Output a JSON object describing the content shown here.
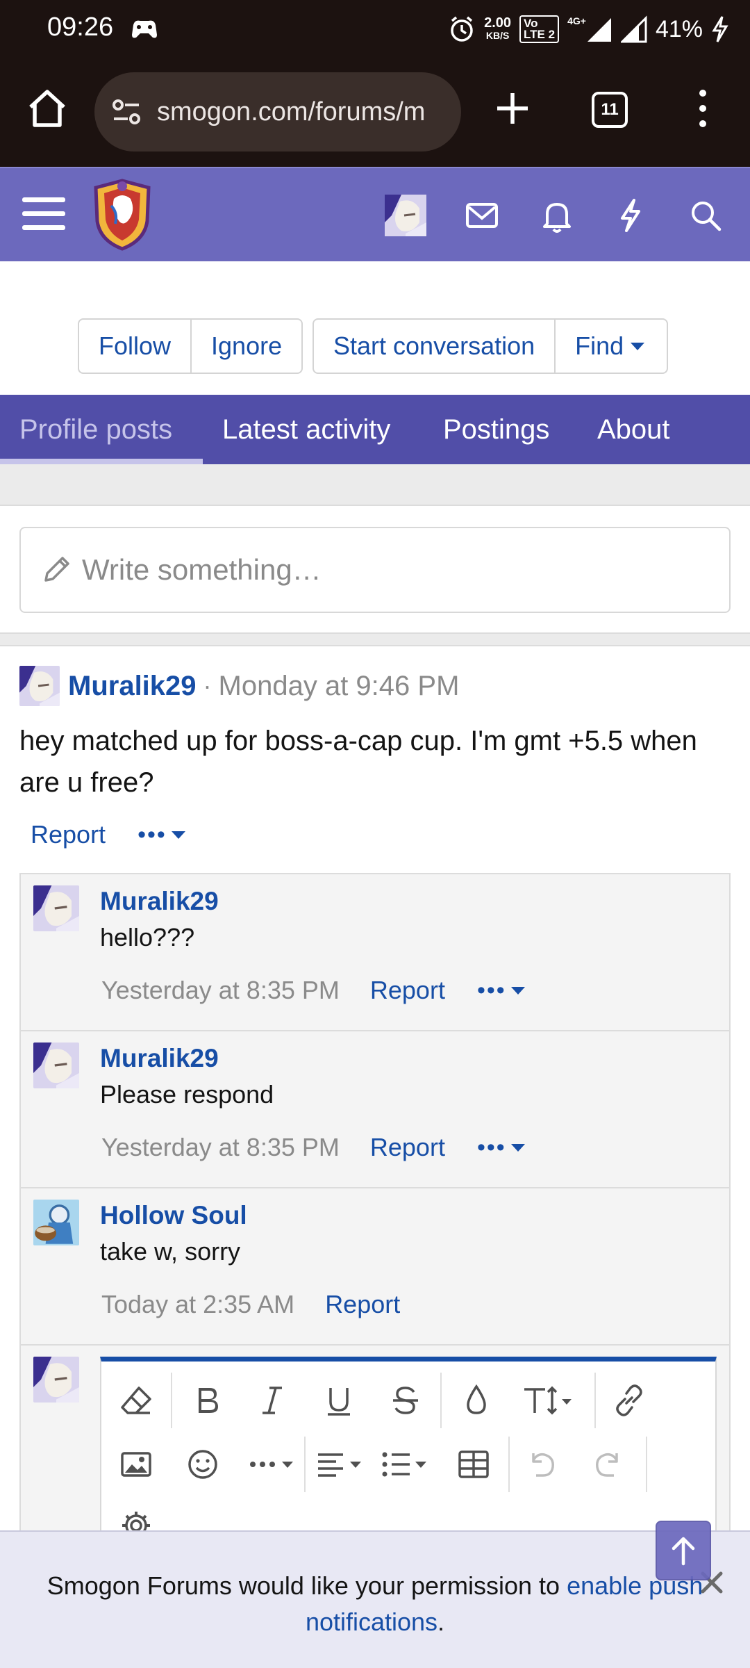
{
  "status_bar": {
    "time": "09:26",
    "net_speed_value": "2.00",
    "net_speed_unit": "KB/S",
    "volte_line1": "Vo",
    "volte_line2": "LTE 2",
    "network": "4G+",
    "battery": "41%"
  },
  "browser": {
    "url": "smogon.com/forums/m",
    "tab_count": "11"
  },
  "profile_buttons": {
    "follow": "Follow",
    "ignore": "Ignore",
    "start_conversation": "Start conversation",
    "find": "Find"
  },
  "tabs": [
    {
      "label": "Profile posts",
      "active": true
    },
    {
      "label": "Latest activity",
      "active": false
    },
    {
      "label": "Postings",
      "active": false
    },
    {
      "label": "About",
      "active": false
    }
  ],
  "write_placeholder": "Write something…",
  "post": {
    "author": "Muralik29",
    "separator": "·",
    "date": "Monday at 9:46 PM",
    "body": "hey matched up for boss-a-cap cup. I'm gmt +5.5 when are u free?",
    "report": "Report",
    "more": "•••"
  },
  "comments": [
    {
      "author": "Muralik29",
      "text": "hello???",
      "time": "Yesterday at 8:35 PM",
      "report": "Report",
      "more": "•••"
    },
    {
      "author": "Muralik29",
      "text": "Please respond",
      "time": "Yesterday at 8:35 PM",
      "report": "Report",
      "more": "•••"
    },
    {
      "author": "Hollow Soul",
      "text": "take w, sorry",
      "time": "Today at 2:35 AM",
      "report": "Report"
    }
  ],
  "editor_toolbar": [
    "eraser-icon",
    "bold-icon",
    "italic-icon",
    "underline-icon",
    "strikethrough-icon",
    "color-icon",
    "text-size-icon",
    "link-icon",
    "image-icon",
    "emoji-icon",
    "more-options-icon",
    "align-icon",
    "list-icon",
    "table-icon",
    "undo-icon",
    "redo-icon",
    "settings-icon"
  ],
  "notification": {
    "text_before": "Smogon Forums would like your permission to ",
    "link_text": "enable push notifications",
    "text_after": "."
  },
  "colors": {
    "header": "#6c69bd",
    "tabs": "#514ea8",
    "link": "#174ea6",
    "browser_bg": "#1c1210"
  }
}
